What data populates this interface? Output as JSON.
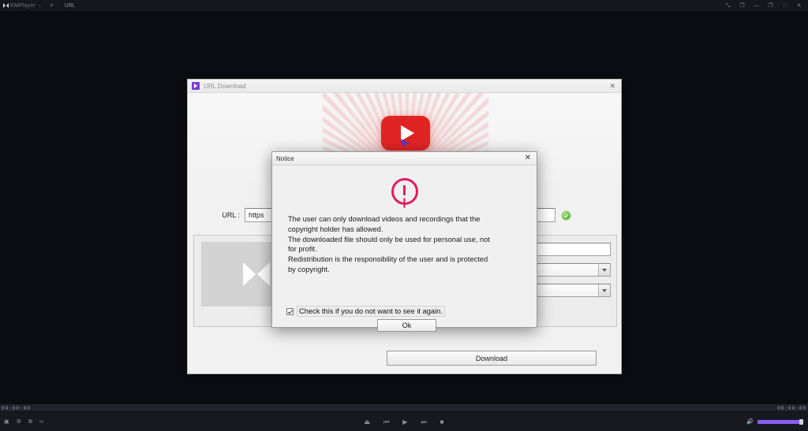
{
  "app": {
    "brand": "KMPlayer",
    "tab_label": "URL",
    "add_tab_label": "+",
    "caret": "⌄",
    "window_controls": [
      {
        "name": "pin-icon",
        "glyph": "⤡"
      },
      {
        "name": "screenshot-icon",
        "glyph": "❐"
      },
      {
        "name": "minimize-icon",
        "glyph": "—"
      },
      {
        "name": "maximize-icon",
        "glyph": "❐"
      },
      {
        "name": "restore-icon",
        "glyph": "∷"
      },
      {
        "name": "close-icon",
        "glyph": "✕"
      }
    ]
  },
  "player_controls": {
    "time_left": "00:00:00",
    "time_right": "00:00:00",
    "left_buttons": [
      {
        "name": "playlist-icon",
        "glyph": "▣"
      },
      {
        "name": "settings-icon",
        "glyph": "⚙"
      },
      {
        "name": "capture-icon",
        "glyph": "⧉"
      },
      {
        "name": "ab-repeat-icon",
        "glyph": "∞"
      }
    ],
    "center_buttons": [
      {
        "name": "eject-icon",
        "glyph": "⏏"
      },
      {
        "name": "previous-icon",
        "glyph": "⏮"
      },
      {
        "name": "play-icon",
        "glyph": "▶"
      },
      {
        "name": "next-icon",
        "glyph": "⏭"
      },
      {
        "name": "stop-icon",
        "glyph": "■"
      }
    ],
    "volume_icon": "🔊",
    "volume_percent": 93,
    "accent_color": "#8b5cf6"
  },
  "url_download_window": {
    "title": "URL Download",
    "close_label": "✕",
    "url_field": {
      "label": "URL :",
      "value": "https",
      "placeholder": "https://"
    },
    "validation_icon": "check-circle-green",
    "fields": {
      "title_value": "",
      "quality_value": "",
      "format_value": ""
    },
    "download_button": "Download"
  },
  "notice_dialog": {
    "title": "Notice",
    "close_label": "✕",
    "icon": "exclamation-circle",
    "icon_color": "#e31b62",
    "message": "The user can only download videos and recordings that the\ncopyright holder has allowed.\nThe downloaded file should only be used for personal use, not\nfor profit.\nRedistribution is the responsibility of the user and is protected\nby copyright.",
    "checkbox_label": "Check this if you do not want to see it again.",
    "checkbox_checked": true,
    "ok_button": "Ok"
  }
}
